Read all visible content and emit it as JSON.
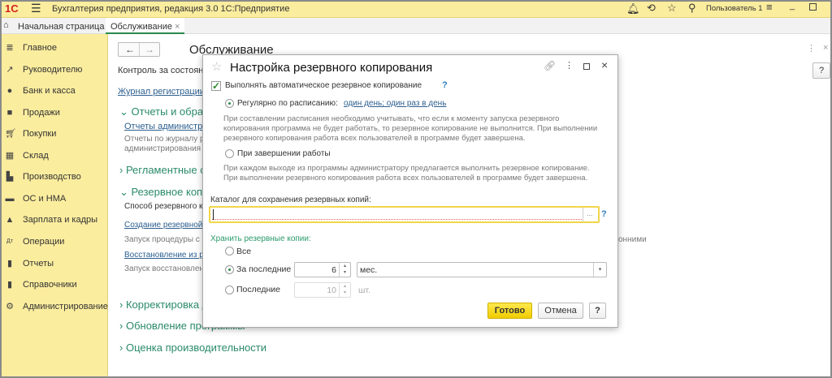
{
  "titlebar": {
    "logo": "1С",
    "app_title": "Бухгалтерия предприятия, редакция 3.0 1С:Предприятие",
    "user": "Пользователь 1"
  },
  "tabs": {
    "home": "Начальная страница",
    "active": "Обслуживание"
  },
  "sidebar": {
    "items": [
      {
        "label": "Главное",
        "icon": "menu-icon"
      },
      {
        "label": "Руководителю",
        "icon": "trend-icon"
      },
      {
        "label": "Банк и касса",
        "icon": "coin-icon"
      },
      {
        "label": "Продажи",
        "icon": "bag-icon"
      },
      {
        "label": "Покупки",
        "icon": "cart-icon"
      },
      {
        "label": "Склад",
        "icon": "warehouse-icon"
      },
      {
        "label": "Производство",
        "icon": "factory-icon"
      },
      {
        "label": "ОС и НМА",
        "icon": "truck-icon"
      },
      {
        "label": "Зарплата и кадры",
        "icon": "person-icon"
      },
      {
        "label": "Операции",
        "icon": "dt-kt-icon"
      },
      {
        "label": "Отчеты",
        "icon": "bar-chart-icon"
      },
      {
        "label": "Справочники",
        "icon": "books-icon"
      },
      {
        "label": "Администрирование",
        "icon": "gear-icon"
      }
    ]
  },
  "page": {
    "title": "Обслуживание",
    "control": "Контроль за состояние",
    "journal_link": "Журнал регистрации",
    "sec_reports": "Отчеты и обрабо",
    "reports_link": "Отчеты администрато",
    "reports_desc1": "Отчеты по журналу р",
    "reports_desc2": "администрирования п",
    "sec_routine": "Регламентные с",
    "sec_backup": "Резервное копир",
    "backup_method": "Способ резервного ко",
    "create_link": "Создание резервной",
    "create_desc": "Запуск процедуры с",
    "create_desc_tail": "онними",
    "restore_link": "Восстановление из р",
    "restore_desc": "Запуск восстановлен",
    "sec_correct": "Корректировка д",
    "sec_update": "Обновление программы",
    "sec_perf": "Оценка производительности",
    "help": "?"
  },
  "dialog": {
    "title": "Настройка резервного копирования",
    "auto_label": "Выполнять автоматическое резервное копирование",
    "help": "?",
    "schedule_label": "Регулярно по расписанию:",
    "schedule_link": "один день; один раз в день",
    "schedule_note": [
      "При составлении расписания необходимо учитывать, что если к моменту запуска резервного",
      "копирования программа не будет работать, то резервное копирование не выполнится. При выполнении",
      "резервного копирования работа всех пользователей в программе будет завершена."
    ],
    "exit_label": "При завершении работы",
    "exit_note": [
      "При каждом выходе из программы администратору предлагается выполнить резервное копирование.",
      "При выполнении резервного копирования работа всех пользователей в программе будет завершена."
    ],
    "catalog_label": "Каталог для сохранения резервных копий:",
    "catalog_value": "",
    "browse": "...",
    "keep_label": "Хранить резервные копии:",
    "keep_all": "Все",
    "keep_period": "За последние",
    "period_value": "6",
    "period_unit": "мес.",
    "keep_last": "Последние",
    "last_value": "10",
    "last_unit": "шт.",
    "ok": "Готово",
    "cancel": "Отмена"
  },
  "colors": {
    "accent": "#fbed9e",
    "green": "#2a8a6a",
    "link": "#2d5f8f",
    "ok_button": "#f5d400"
  }
}
